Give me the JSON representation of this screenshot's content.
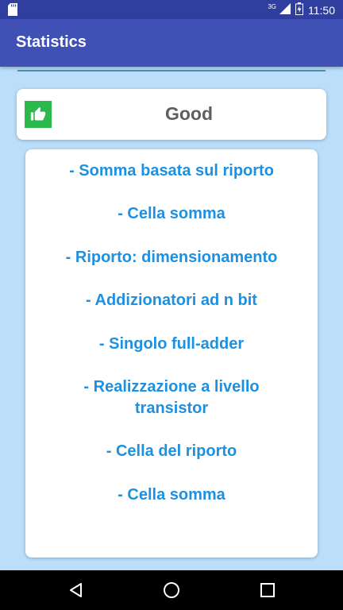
{
  "status_bar": {
    "network": "3G",
    "time": "11:50"
  },
  "app_bar": {
    "title": "Statistics"
  },
  "result": {
    "label": "Good",
    "icon": "thumbs-up-icon",
    "icon_color": "#2db84d"
  },
  "topics": [
    "- Somma basata sul riporto",
    "- Cella somma",
    "- Riporto: dimensionamento",
    "- Addizionatori ad n bit",
    "- Singolo full-adder",
    "- Realizzazione a livello transistor",
    "- Cella del riporto",
    "- Cella somma"
  ],
  "colors": {
    "primary": "#3f51b5",
    "primary_dark": "#303f9f",
    "background": "#bbdefb",
    "topic_text": "#1e90e0"
  }
}
